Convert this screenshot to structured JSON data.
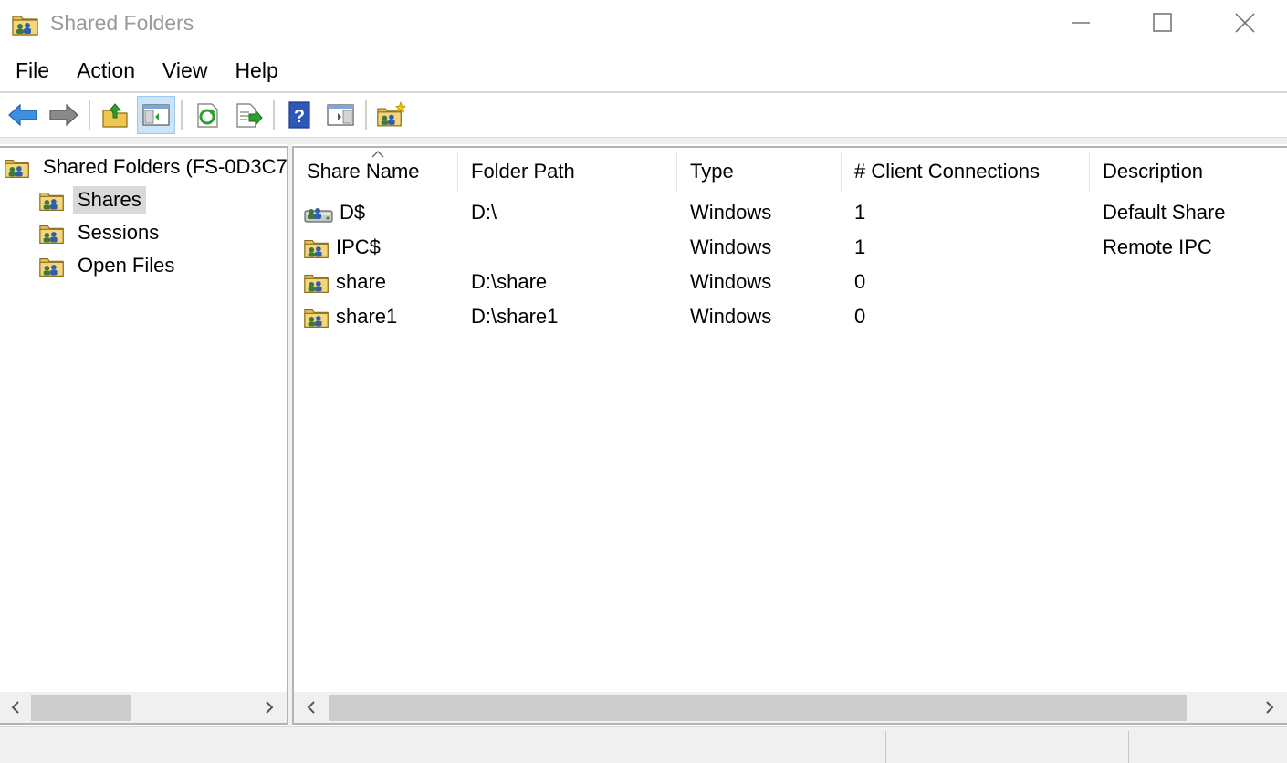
{
  "window": {
    "title": "Shared Folders",
    "icon": "shared-folder-icon",
    "controls": [
      "minimize-icon",
      "maximize-icon",
      "close-icon"
    ]
  },
  "menu": {
    "items": [
      {
        "label": "File"
      },
      {
        "label": "Action"
      },
      {
        "label": "View"
      },
      {
        "label": "Help"
      }
    ]
  },
  "toolbar": {
    "buttons": [
      "back-arrow-icon",
      "forward-arrow-icon",
      "up-folder-icon",
      "show-hide-tree-icon",
      "refresh-icon",
      "export-list-icon",
      "help-icon",
      "show-hide-action-pane-icon",
      "new-share-icon"
    ],
    "active": "show-hide-tree-icon"
  },
  "tree": {
    "root": "Shared Folders (FS-0D3C7",
    "children": [
      {
        "label": "Shares",
        "selected": true
      },
      {
        "label": "Sessions"
      },
      {
        "label": "Open Files"
      }
    ]
  },
  "list": {
    "sort_column": "Share Name",
    "columns": [
      "Share Name",
      "Folder Path",
      "Type",
      "# Client Connections",
      "Description"
    ],
    "rows": [
      {
        "name": "D$",
        "path": "D:\\",
        "type": "Windows",
        "connections": "1",
        "description": "Default Share",
        "icon": "drive-share-icon"
      },
      {
        "name": "IPC$",
        "path": "",
        "type": "Windows",
        "connections": "1",
        "description": "Remote IPC",
        "icon": "shared-folder-icon"
      },
      {
        "name": "share",
        "path": "D:\\share",
        "type": "Windows",
        "connections": "0",
        "description": "",
        "icon": "shared-folder-icon"
      },
      {
        "name": "share1",
        "path": "D:\\share1",
        "type": "Windows",
        "connections": "0",
        "description": "",
        "icon": "shared-folder-icon"
      }
    ]
  },
  "colors": {
    "selection": "#d9d9d9",
    "active_button": "#cce4f7",
    "pane_border": "#b3b3b3",
    "chrome": "#f0f0f0"
  }
}
